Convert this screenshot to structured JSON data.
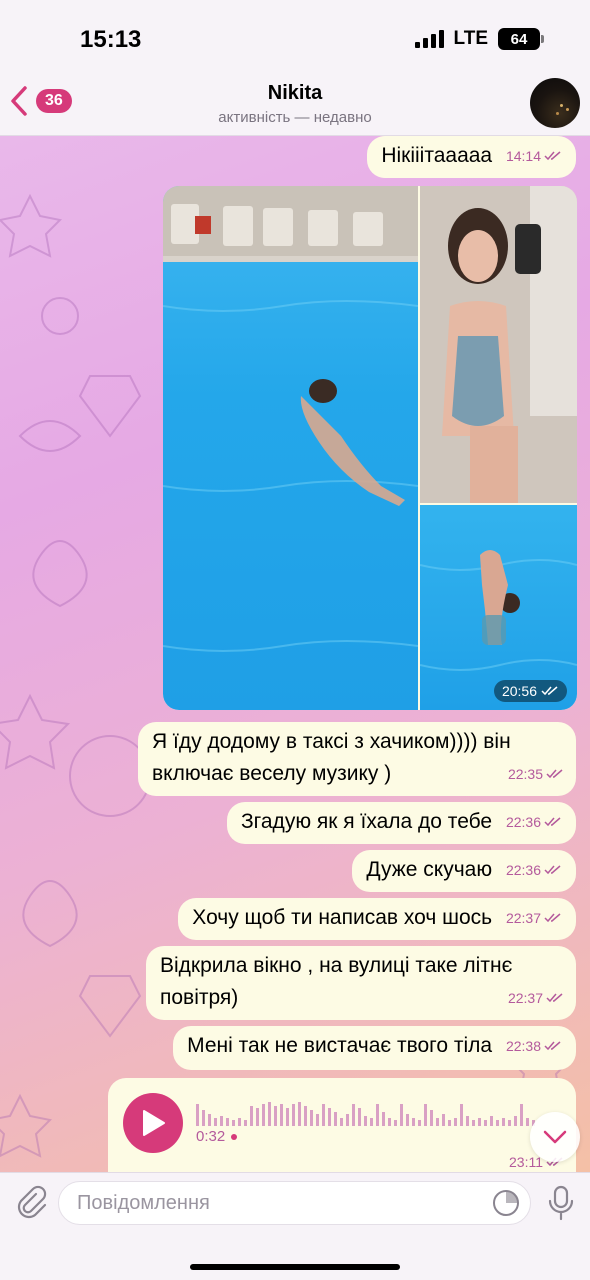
{
  "status_bar": {
    "time": "15:13",
    "network": "LTE",
    "battery": "64"
  },
  "header": {
    "back_count": "36",
    "title": "Nikita",
    "subtitle": "активність — недавно"
  },
  "messages": [
    {
      "text": "Нікііітааааа",
      "time": "14:14"
    },
    {
      "album_time": "20:56"
    },
    {
      "text": "Я їду додому в таксі з хачиком)))) він включає веселу музику )",
      "time": "22:35"
    },
    {
      "text": "Згадую як я їхала до тебе",
      "time": "22:36"
    },
    {
      "text": "Дуже скучаю",
      "time": "22:36"
    },
    {
      "text": "Хочу щоб ти написав хоч шось",
      "time": "22:37"
    },
    {
      "text": "Відкрила вікно , на вулиці таке літнє повітря)",
      "time": "22:37"
    },
    {
      "text": "Мені так не вистачає твого тіла",
      "time": "22:38"
    }
  ],
  "voice": {
    "duration": "0:32",
    "time": "23:11"
  },
  "input": {
    "placeholder": "Повідомлення"
  },
  "colors": {
    "accent": "#d63a7a",
    "bubble": "#fdfbe4",
    "meta": "#b45a9c"
  }
}
